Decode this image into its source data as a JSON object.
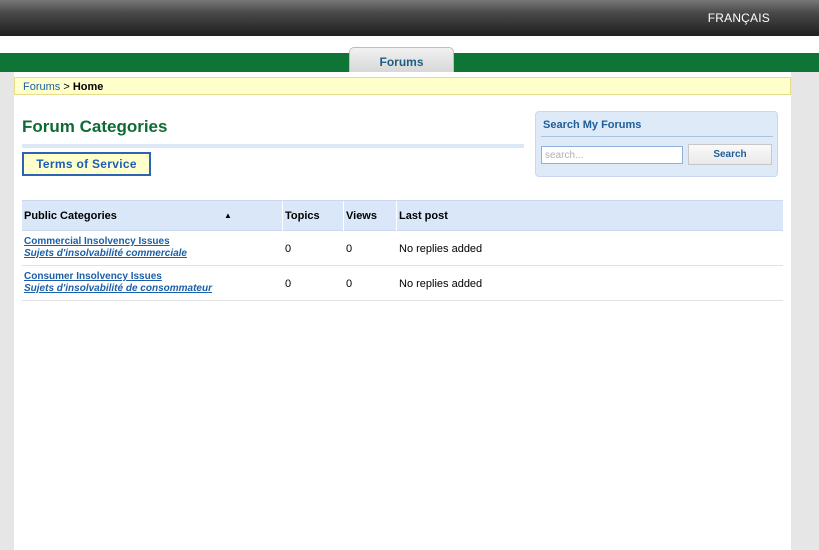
{
  "header": {
    "language_link": "FRANÇAIS"
  },
  "nav": {
    "tab_label": "Forums"
  },
  "breadcrumb": {
    "parent": "Forums",
    "separator": ">",
    "current": "Home"
  },
  "main": {
    "title": "Forum Categories",
    "tos_button": "Terms of Service"
  },
  "search": {
    "title": "Search My Forums",
    "placeholder": "search...",
    "value": "",
    "button": "Search"
  },
  "table": {
    "columns": [
      "Public Categories",
      "Topics",
      "Views",
      "Last post"
    ],
    "sort_indicator": "▲",
    "rows": [
      {
        "name": "Commercial Insolvency Issues",
        "name_fr": "Sujets d'insolvabilité commerciale",
        "topics": "0",
        "views": "0",
        "last_post": "No replies added"
      },
      {
        "name": "Consumer Insolvency Issues",
        "name_fr": "Sujets d'insolvabilité de consommateur",
        "topics": "0",
        "views": "0",
        "last_post": "No replies added"
      }
    ]
  }
}
